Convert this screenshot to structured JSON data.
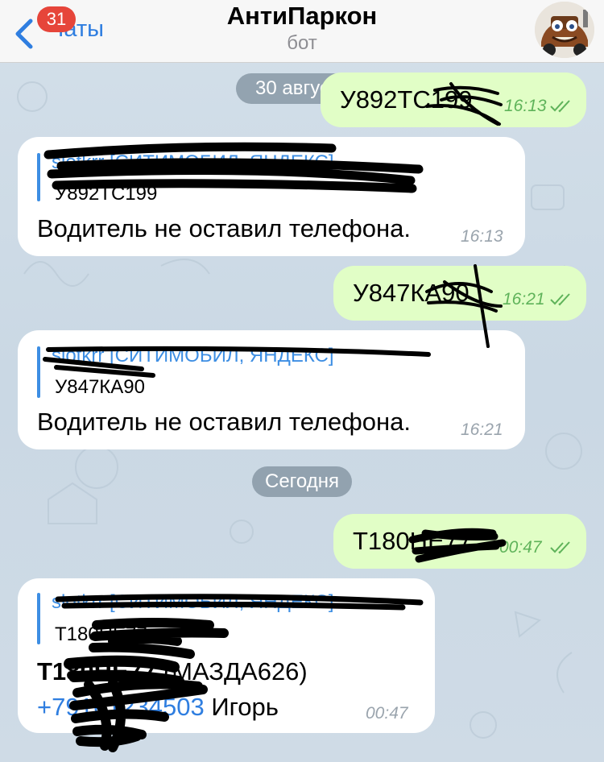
{
  "header": {
    "back_label": "Чаты",
    "unread_count": "31",
    "title": "АнтиПаркон",
    "subtitle": "бот"
  },
  "dates": {
    "aug30": "30 августа",
    "today": "Сегодня"
  },
  "messages": {
    "m1": {
      "text": "У892ТС199",
      "time": "16:13"
    },
    "m2": {
      "quote_name": "slotkrr [СИТИМОБИЛ, ЯНДЕКС]",
      "quote_text": "У892ТС199",
      "text": "Водитель не оставил телефона.",
      "time": "16:13"
    },
    "m3": {
      "text": "У847КА90",
      "time": "16:21"
    },
    "m4": {
      "quote_name": "slotkrr [СИТИМОБИЛ, ЯНДЕКС]",
      "quote_text": "У847КА90",
      "text": "Водитель не оставил телефона.",
      "time": "16:21"
    },
    "m5": {
      "text": "Т180НЕ77",
      "time": "00:47"
    },
    "m6": {
      "quote_name": "slotkrr [СИТИМОБИЛ, ЯНДЕКС]",
      "quote_text": "Т180НЕ77",
      "line1_bold": "Т180НЕ77",
      "line1_rest": " (МАЗДА626)",
      "phone": "+79161234503",
      "name": " Игорь",
      "time": "00:47"
    }
  },
  "colors": {
    "accent": "#2f7ee0",
    "badge": "#e6453a",
    "outgoing_bubble": "#e1fec6",
    "incoming_bubble": "#ffffff",
    "read_check": "#5fb35a"
  },
  "icons": {
    "back": "chevron-left-icon",
    "read": "double-check-icon",
    "avatar": "bot-avatar-icon"
  }
}
